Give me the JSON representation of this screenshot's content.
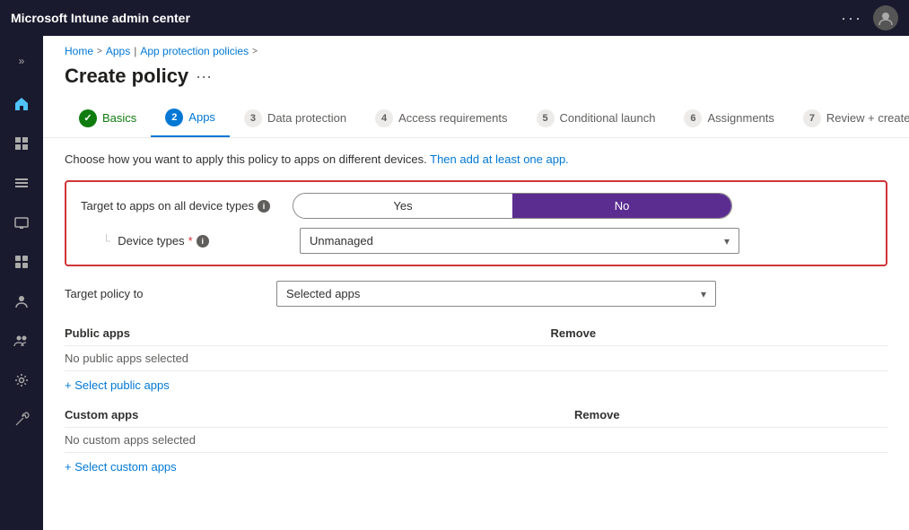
{
  "topbar": {
    "title": "Microsoft Intune admin center",
    "dots": "···",
    "avatar_initials": ""
  },
  "sidebar": {
    "chevron": "»",
    "items": [
      {
        "name": "home-icon",
        "icon": "⌂"
      },
      {
        "name": "dashboard-icon",
        "icon": "▦"
      },
      {
        "name": "list-icon",
        "icon": "≡"
      },
      {
        "name": "device-icon",
        "icon": "□"
      },
      {
        "name": "grid-icon",
        "icon": "⊞"
      },
      {
        "name": "people-icon",
        "icon": "👤"
      },
      {
        "name": "group-icon",
        "icon": "👥"
      },
      {
        "name": "gear-icon",
        "icon": "⚙"
      },
      {
        "name": "tools-icon",
        "icon": "✕"
      }
    ]
  },
  "breadcrumb": {
    "home": "Home",
    "apps": "Apps",
    "separator1": ">",
    "policies": "App protection policies",
    "separator2": ">"
  },
  "page_header": {
    "title": "Create policy",
    "dots": "···"
  },
  "steps": [
    {
      "number": "✓",
      "label": "Basics",
      "state": "completed"
    },
    {
      "number": "2",
      "label": "Apps",
      "state": "active"
    },
    {
      "number": "3",
      "label": "Data protection",
      "state": "inactive"
    },
    {
      "number": "4",
      "label": "Access requirements",
      "state": "inactive"
    },
    {
      "number": "5",
      "label": "Conditional launch",
      "state": "inactive"
    },
    {
      "number": "6",
      "label": "Assignments",
      "state": "inactive"
    },
    {
      "number": "7",
      "label": "Review + create",
      "state": "inactive"
    }
  ],
  "description": {
    "text_before": "Choose how you want to apply this policy to apps on different devices.",
    "link_text": "Then add at least one app.",
    "text_after": ""
  },
  "target_box": {
    "label": "Target to apps on all device types",
    "yes_label": "Yes",
    "no_label": "No",
    "selected": "No",
    "device_types_label": "Device types",
    "device_types_required": "*",
    "device_types_value": "Unmanaged"
  },
  "target_policy": {
    "label": "Target policy to",
    "value": "Selected apps"
  },
  "public_apps": {
    "column1": "Public apps",
    "column2": "Remove",
    "no_apps_text": "No public apps selected",
    "select_link": "+ Select public apps"
  },
  "custom_apps": {
    "column1": "Custom apps",
    "column2": "Remove",
    "no_apps_text": "No custom apps selected",
    "select_link": "+ Select custom apps"
  },
  "colors": {
    "active_step": "#0078d4",
    "completed_step": "#107c10",
    "toggle_selected": "#5c2d91",
    "error_red": "#d13438",
    "link_blue": "#0078d4"
  }
}
